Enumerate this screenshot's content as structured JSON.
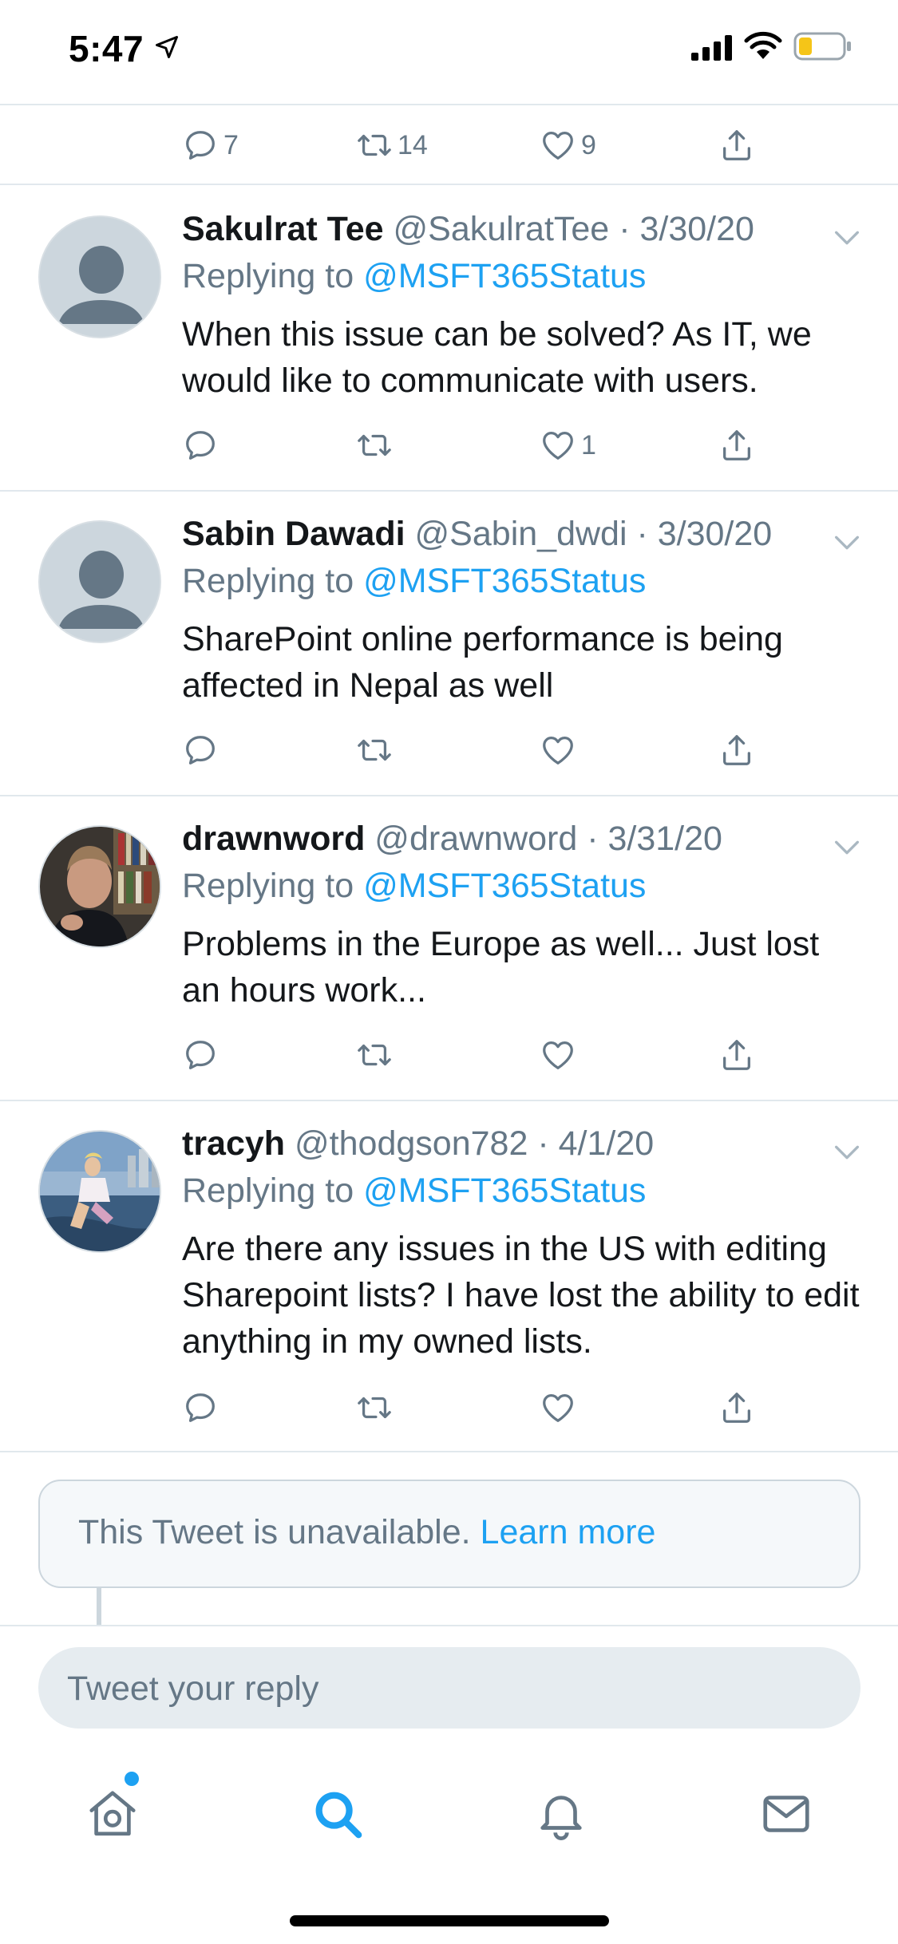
{
  "status_bar": {
    "time": "5:47"
  },
  "prev_tweet_actions": {
    "reply_count": "7",
    "retweet_count": "14",
    "like_count": "9"
  },
  "tweets": [
    {
      "name": "Sakulrat Tee",
      "handle": "@SakulratTee",
      "date": "· 3/30/20",
      "replying_label": "Replying to",
      "replying_to": "@MSFT365Status",
      "text": "When this issue can be solved? As IT, we would like to communicate with users.",
      "reply_count": "",
      "retweet_count": "",
      "like_count": "1"
    },
    {
      "name": "Sabin Dawadi",
      "handle": "@Sabin_dwdi",
      "date": "· 3/30/20",
      "replying_label": "Replying to",
      "replying_to": "@MSFT365Status",
      "text": "SharePoint online performance is being affected in Nepal as well",
      "reply_count": "",
      "retweet_count": "",
      "like_count": ""
    },
    {
      "name": "drawnword",
      "handle": "@drawnword",
      "date": "· 3/31/20",
      "replying_label": "Replying to",
      "replying_to": "@MSFT365Status",
      "text": "Problems in the Europe as well... Just lost an hours work...",
      "reply_count": "",
      "retweet_count": "",
      "like_count": ""
    },
    {
      "name": "tracyh",
      "handle": "@thodgson782",
      "date": "· 4/1/20",
      "replying_label": "Replying to",
      "replying_to": "@MSFT365Status",
      "text": "Are there any issues in the US with editing Sharepoint lists? I have lost the ability to edit anything in my owned lists.",
      "reply_count": "",
      "retweet_count": "",
      "like_count": ""
    }
  ],
  "unavailable": {
    "text": "This Tweet is unavailable.",
    "link": "Learn more"
  },
  "reply_box": {
    "placeholder": "Tweet your reply"
  },
  "tab_bar": {
    "tabs": [
      "home-icon",
      "search-icon",
      "bell-icon",
      "mail-icon"
    ],
    "active_tab": "search-icon",
    "accent": "#1da1f2"
  }
}
